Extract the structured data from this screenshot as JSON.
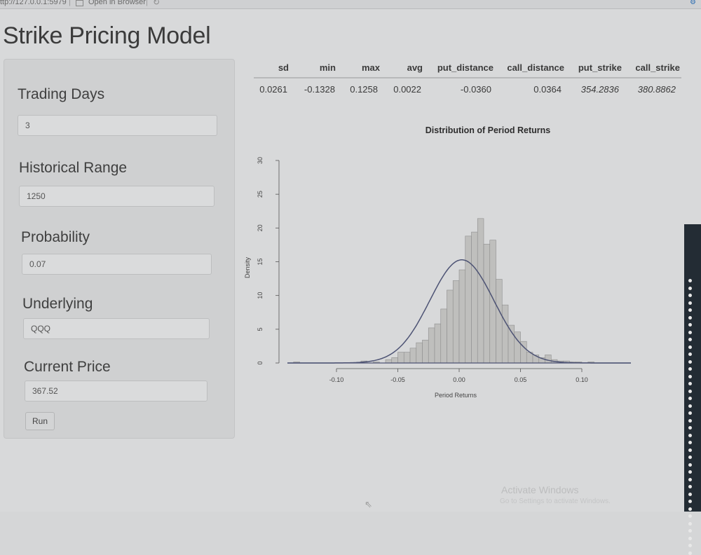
{
  "browser": {
    "url": "ttp://127.0.0.1:5979",
    "open_in_browser": "Open in Browser"
  },
  "app": {
    "title": "Strike Pricing Model"
  },
  "inputs": {
    "trading_days": {
      "label": "Trading Days",
      "value": "3"
    },
    "historical_range": {
      "label": "Historical Range",
      "value": "1250"
    },
    "probability": {
      "label": "Probability",
      "value": "0.07"
    },
    "underlying": {
      "label": "Underlying",
      "value": "QQQ"
    },
    "current_price": {
      "label": "Current Price",
      "value": "367.52"
    },
    "run_label": "Run"
  },
  "stats": {
    "headers": [
      "sd",
      "min",
      "max",
      "avg",
      "put_distance",
      "call_distance",
      "put_strike",
      "call_strike"
    ],
    "values": [
      "0.0261",
      "-0.1328",
      "0.1258",
      "0.0022",
      "-0.0360",
      "0.0364",
      "354.2836",
      "380.8862"
    ]
  },
  "chart_data": {
    "type": "bar",
    "title": "Distribution of Period Returns",
    "xlabel": "Period Returns",
    "ylabel": "Density",
    "xlim": [
      -0.14,
      0.14
    ],
    "ylim": [
      0,
      30
    ],
    "xticks": [
      "-0.10",
      "-0.05",
      "0.00",
      "0.05",
      "0.10"
    ],
    "yticks": [
      "0",
      "5",
      "10",
      "15",
      "20",
      "25",
      "30"
    ],
    "bin_width": 0.005,
    "bin_starts": [
      -0.14,
      -0.135,
      -0.13,
      -0.125,
      -0.12,
      -0.115,
      -0.11,
      -0.105,
      -0.1,
      -0.095,
      -0.09,
      -0.085,
      -0.08,
      -0.075,
      -0.07,
      -0.065,
      -0.06,
      -0.055,
      -0.05,
      -0.045,
      -0.04,
      -0.035,
      -0.03,
      -0.025,
      -0.02,
      -0.015,
      -0.01,
      -0.005,
      0,
      0.005,
      0.01,
      0.015,
      0.02,
      0.025,
      0.03,
      0.035,
      0.04,
      0.045,
      0.05,
      0.055,
      0.06,
      0.065,
      0.07,
      0.075,
      0.08,
      0.085,
      0.09,
      0.095,
      0.1,
      0.105,
      0.11,
      0.115,
      0.12,
      0.125
    ],
    "densities": [
      0,
      0.16,
      0,
      0,
      0,
      0,
      0,
      0,
      0,
      0,
      0,
      0,
      0.3,
      0,
      0.16,
      0,
      0.5,
      0.8,
      1.6,
      1.6,
      2.2,
      3.0,
      3.4,
      5.2,
      5.8,
      8.0,
      10.8,
      12.2,
      13.8,
      18.8,
      19.4,
      21.4,
      17.6,
      18.2,
      12.4,
      8.6,
      5.6,
      4.6,
      3.2,
      1.6,
      1.2,
      0.8,
      1.2,
      0.5,
      0.3,
      0.3,
      0.16,
      0.16,
      0,
      0.16,
      0,
      0,
      0,
      0
    ],
    "density_curve": {
      "mean": 0.0022,
      "sd": 0.0261
    }
  },
  "watermark": {
    "line1": "Activate Windows",
    "line2": "Go to Settings to activate Windows."
  }
}
